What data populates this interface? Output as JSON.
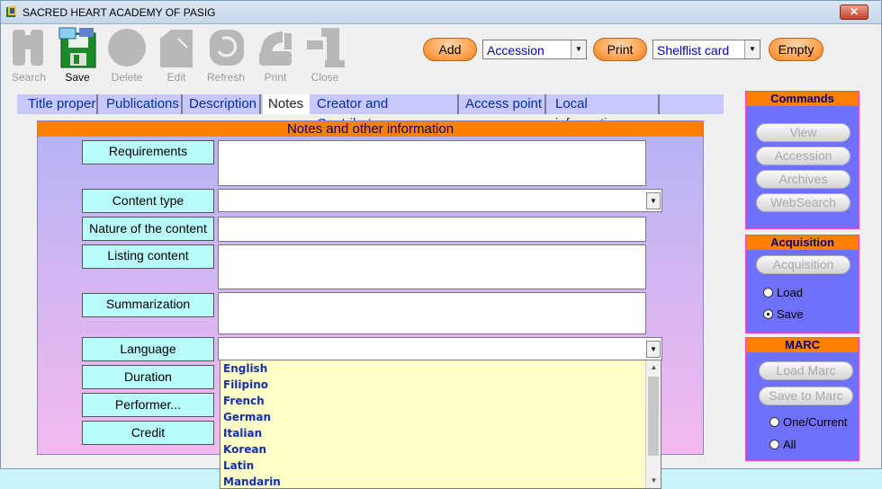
{
  "window": {
    "title": "SACRED HEART ACADEMY OF PASIG"
  },
  "toolbar": [
    {
      "label": "Search",
      "icon": "search-icon",
      "enabled": false
    },
    {
      "label": "Save",
      "icon": "save-icon",
      "enabled": true
    },
    {
      "label": "Delete",
      "icon": "delete-icon",
      "enabled": false
    },
    {
      "label": "Edit",
      "icon": "edit-icon",
      "enabled": false
    },
    {
      "label": "Refresh",
      "icon": "refresh-icon",
      "enabled": false
    },
    {
      "label": "Print",
      "icon": "print-icon",
      "enabled": false
    },
    {
      "label": "Close",
      "icon": "close-icon",
      "enabled": false
    }
  ],
  "actions": {
    "add_label": "Add",
    "add_select": "Accession",
    "print_label": "Print",
    "print_select": "Shelflist card",
    "empty_label": "Empty"
  },
  "tabs": [
    "Title proper",
    "Publications",
    "Description",
    "Notes",
    "Creator and Contributor",
    "Access point",
    "Local information"
  ],
  "panel": {
    "header": "Notes and other information",
    "fields": [
      {
        "label": "Requirements",
        "value": ""
      },
      {
        "label": "Content type",
        "value": ""
      },
      {
        "label": "Nature of the content",
        "value": ""
      },
      {
        "label": "Listing content",
        "value": ""
      },
      {
        "label": "Summarization",
        "value": ""
      },
      {
        "label": "Language",
        "value": ""
      },
      {
        "label": "Duration",
        "value": ""
      },
      {
        "label": "Performer...",
        "value": ""
      },
      {
        "label": "Credit",
        "value": ""
      }
    ]
  },
  "language_options": [
    "English",
    "Filipino",
    "French",
    "German",
    "Italian",
    "Korean",
    "Latin",
    "Mandarin"
  ],
  "commands": {
    "title": "Commands",
    "buttons": [
      "View",
      "Accession",
      "Archives",
      "WebSearch"
    ]
  },
  "acquisition": {
    "title": "Acquisition",
    "button": "Acquisition",
    "options": [
      "Load",
      "Save"
    ],
    "selected": "Save"
  },
  "marc": {
    "title": "MARC",
    "buttons": [
      "Load Marc",
      "Save to Marc"
    ],
    "options": [
      "One/Current",
      "All"
    ]
  },
  "colors": {
    "accent_orange": "#ff8000",
    "panel_top": "#b4b4f4",
    "panel_bottom": "#f4b8f0",
    "label_bg": "#b8fcfc",
    "side_panel": "#7070ff"
  }
}
